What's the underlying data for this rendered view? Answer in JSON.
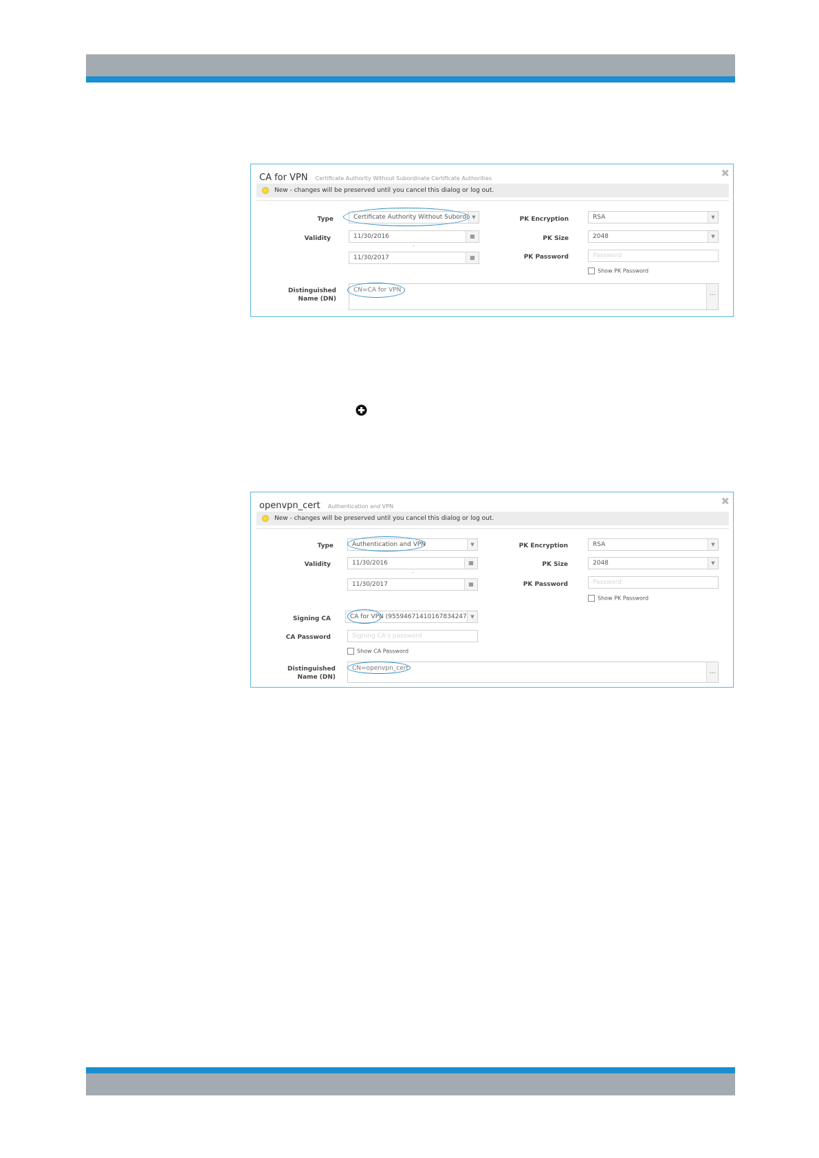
{
  "dialog1": {
    "name": "CA for VPN",
    "type_desc": "Certificate Authority Without Subordinate Certificate Authorities",
    "notice": "New - changes will be preserved until you cancel this dialog or log out.",
    "type_label": "Type",
    "type_value": "Certificate Authority Without Subordi...",
    "validity_label": "Validity",
    "validity_from": "11/30/2016",
    "validity_to": "11/30/2017",
    "pk_encryption_label": "PK Encryption",
    "pk_encryption_value": "RSA",
    "pk_size_label": "PK Size",
    "pk_size_value": "2048",
    "pk_password_label": "PK Password",
    "pk_password_placeholder": "Password",
    "show_pk_password": "Show PK Password",
    "dn_label_1": "Distinguished",
    "dn_label_2": "Name (DN)",
    "dn_value": "CN=CA for VPN"
  },
  "dialog2": {
    "name": "openvpn_cert",
    "type_desc": "Authentication and VPN",
    "notice": "New - changes will be preserved until you cancel this dialog or log out.",
    "type_label": "Type",
    "type_value": "Authentication and VPN",
    "validity_label": "Validity",
    "validity_from": "11/30/2016",
    "validity_to": "11/30/2017",
    "pk_encryption_label": "PK Encryption",
    "pk_encryption_value": "RSA",
    "pk_size_label": "PK Size",
    "pk_size_value": "2048",
    "pk_password_label": "PK Password",
    "pk_password_placeholder": "Password",
    "show_pk_password": "Show PK Password",
    "signing_ca_label": "Signing CA",
    "signing_ca_value": "CA for VPN (9559467141016783424728...",
    "ca_password_label": "CA Password",
    "ca_password_placeholder": "Signing CA's password",
    "show_ca_password": "Show CA Password",
    "dn_label_1": "Distinguished",
    "dn_label_2": "Name (DN)",
    "dn_value": "CN=openvpn_cert"
  },
  "icons": {
    "dropdown": "chevron-down-icon",
    "calendar": "calendar-icon",
    "close": "close-icon",
    "add": "plus-circle-icon",
    "notice": "lightbulb-icon"
  },
  "colors": {
    "accent_blue": "#1a8fd0",
    "band_grey": "#a4abb0",
    "highlight_oval": "#2a8fca"
  }
}
